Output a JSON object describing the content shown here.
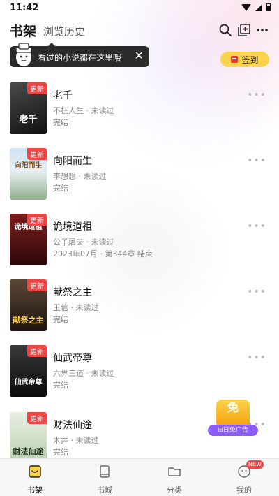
{
  "status_bar": {
    "time": "11:42"
  },
  "header": {
    "tab_bookshelf": "书架",
    "tab_history": "浏览历史"
  },
  "tooltip": {
    "text": "看过的小说都在这里哦",
    "close": "✕"
  },
  "checkin": {
    "label": "签到"
  },
  "update_badge": "更新",
  "books": [
    {
      "title": "老千",
      "meta": "不枉人生 · 未读过",
      "status": "完结",
      "cover_text": "老千",
      "cover_colors": [
        "#2a2a2a",
        "#6b6b6b"
      ]
    },
    {
      "title": "向阳而生",
      "meta": "李想想 · 未读过",
      "status": "完结",
      "cover_text": "向阳而生",
      "cover_colors": [
        "#d7e6f2",
        "#b6c9a5"
      ]
    },
    {
      "title": "诡境道祖",
      "meta": "公子屠夫 · 未读过",
      "status": "2023年07月 · 第344章 结束",
      "cover_text": "诡境道祖",
      "cover_colors": [
        "#3a0d0d",
        "#b91c1c"
      ]
    },
    {
      "title": "献祭之主",
      "meta": "王信 · 未读过",
      "status": "完结",
      "cover_text": "献祭之主",
      "cover_colors": [
        "#2d1f17",
        "#8b5a2b"
      ]
    },
    {
      "title": "仙武帝尊",
      "meta": "六界三道 · 未读过",
      "status": "完结",
      "cover_text": "仙武帝尊",
      "cover_colors": [
        "#111111",
        "#3f3f3f"
      ]
    },
    {
      "title": "财法仙途",
      "meta": "木井 · 未读过",
      "status": "完结",
      "cover_text": "财法仙途",
      "cover_colors": [
        "#c9d9c1",
        "#e8efe2"
      ]
    }
  ],
  "float_ad": {
    "badge": "免",
    "label": "⊞日免广告"
  },
  "bottom_nav": {
    "items": [
      {
        "label": "书架",
        "active": true
      },
      {
        "label": "书城",
        "active": false
      },
      {
        "label": "分类",
        "active": false
      },
      {
        "label": "我的",
        "active": false,
        "badge": "NEW"
      }
    ]
  },
  "colors": {
    "accent": "#fcd34d",
    "badge_red": "#ef4444"
  }
}
